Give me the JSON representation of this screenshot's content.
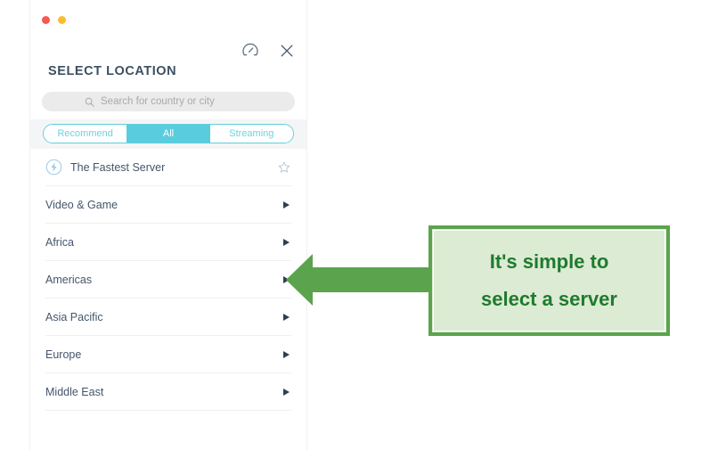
{
  "window": {
    "dots": [
      {
        "name": "close-dot",
        "color": "#f9574f"
      },
      {
        "name": "minimize-dot",
        "color": "#fbbd30"
      }
    ]
  },
  "header": {
    "title": "SELECT LOCATION",
    "icons": [
      {
        "name": "speed-test-icon",
        "label": "Speed test"
      },
      {
        "name": "close-icon",
        "label": "Close"
      }
    ]
  },
  "search": {
    "placeholder": "Search for country or city",
    "value": "",
    "icon": "search-icon"
  },
  "tabs": {
    "items": [
      {
        "label": "Recommend",
        "active": false
      },
      {
        "label": "All",
        "active": true
      },
      {
        "label": "Streaming",
        "active": false
      }
    ],
    "active_color": "#59cddd",
    "border_color": "#62ceda",
    "band_color": "#f4f5f6"
  },
  "list": {
    "rows": [
      {
        "label": "The Fastest Server",
        "type": "fastest",
        "leading_icon": "lightning-bolt-icon",
        "trailing_icon": "star-outline-icon"
      },
      {
        "label": "Video & Game",
        "type": "group",
        "trailing_icon": "caret-right-icon"
      },
      {
        "label": "Africa",
        "type": "group",
        "trailing_icon": "caret-right-icon"
      },
      {
        "label": "Americas",
        "type": "group",
        "trailing_icon": "caret-right-icon"
      },
      {
        "label": "Asia Pacific",
        "type": "group",
        "trailing_icon": "caret-right-icon"
      },
      {
        "label": "Europe",
        "type": "group",
        "trailing_icon": "caret-right-icon"
      },
      {
        "label": "Middle East",
        "type": "group",
        "trailing_icon": "caret-right-icon"
      }
    ]
  },
  "annotation": {
    "text": "It's simple to\nselect a server",
    "arrow_direction": "left",
    "fill_color": "#dcebd3",
    "border_color": "#5ba44d",
    "text_color": "#1f7a2e",
    "arrow_color": "#5ba44d"
  }
}
